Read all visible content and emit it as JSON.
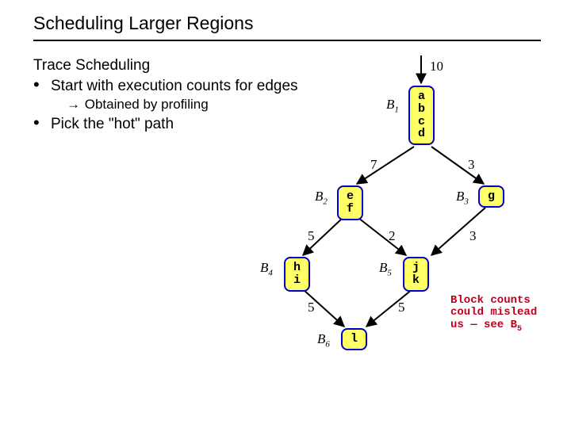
{
  "title": "Scheduling Larger Regions",
  "text": {
    "heading": "Trace Scheduling",
    "b1": "Start with execution counts for edges",
    "b1s1": "Obtained by profiling",
    "b2": "Pick the \"hot\" path"
  },
  "nodes": {
    "B1": {
      "label": "B",
      "sub": "1",
      "lines": [
        "a",
        "b",
        "c",
        "d"
      ]
    },
    "B2": {
      "label": "B",
      "sub": "2",
      "lines": [
        "e",
        "f"
      ]
    },
    "B3": {
      "label": "B",
      "sub": "3",
      "lines": [
        "g"
      ]
    },
    "B4": {
      "label": "B",
      "sub": "4",
      "lines": [
        "h",
        "i"
      ]
    },
    "B5": {
      "label": "B",
      "sub": "5",
      "lines": [
        "j",
        "k"
      ]
    },
    "B6": {
      "label": "B",
      "sub": "6",
      "lines": [
        "l"
      ]
    }
  },
  "weights": {
    "entry": "10",
    "b1_b2": "7",
    "b1_b3": "3",
    "b2_b4": "5",
    "b2_b5": "2",
    "b3_b5": "3",
    "b4_b6": "5",
    "b5_b6": "5"
  },
  "note": {
    "l1": "Block counts",
    "l2": "could mislead",
    "l3_a": "us — see B",
    "l3_b": "5"
  }
}
